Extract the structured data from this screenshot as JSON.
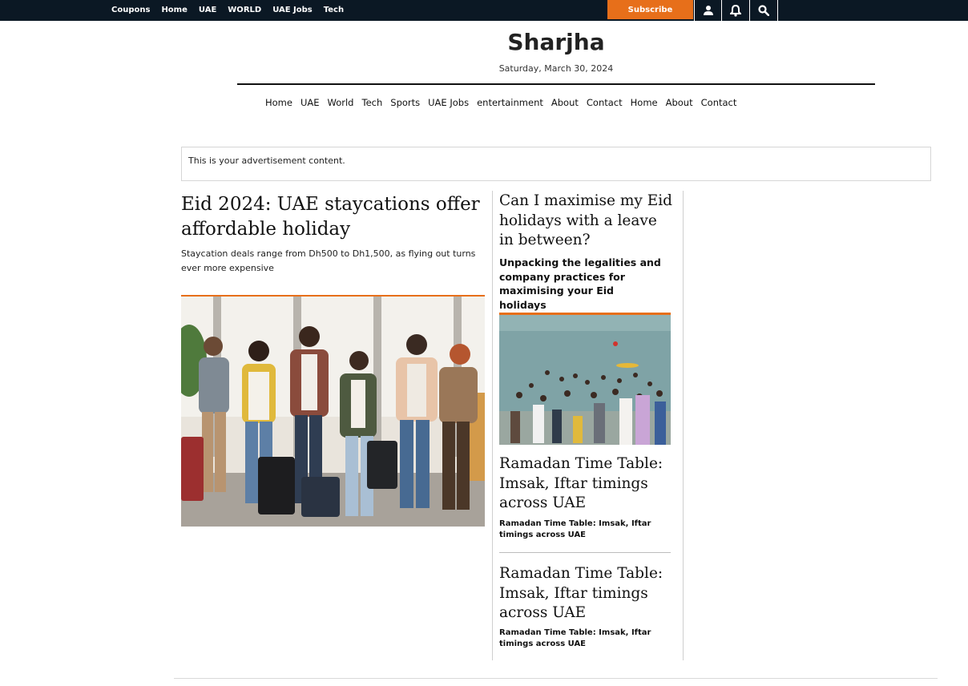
{
  "topbar": {
    "nav": [
      "Coupons",
      "Home",
      "UAE",
      "WORLD",
      "UAE Jobs",
      "Tech"
    ],
    "subscribe_label": "Subscribe",
    "icons": [
      "user-icon",
      "bell-icon",
      "search-icon"
    ]
  },
  "header": {
    "title": "Sharjha",
    "date": "Saturday, March 30, 2024"
  },
  "main_nav": [
    "Home",
    "UAE",
    "World",
    "Tech",
    "Sports",
    "UAE Jobs",
    "entertainment",
    "About",
    "Contact",
    "Home",
    "About",
    "Contact"
  ],
  "ad": {
    "text": "This is your advertisement content."
  },
  "lead": {
    "title": "Eid 2024: UAE staycations offer affordable holiday",
    "summary": "Staycation deals range from Dh500 to Dh1,500, as flying out turns ever more expensive"
  },
  "side": [
    {
      "title": "Can I maximise my Eid holidays with a leave in between?",
      "summary": "Unpacking the legalities and company practices for maximising your Eid holidays"
    },
    {
      "title": "Ramadan Time Table: Imsak, Iftar timings across UAE",
      "summary": "Ramadan Time Table: Imsak, Iftar timings across UAE"
    },
    {
      "title": "Ramadan Time Table: Imsak, Iftar timings across UAE",
      "summary": "Ramadan Time Table: Imsak, Iftar timings across UAE"
    }
  ],
  "colors": {
    "topbar": "#0b1824",
    "accent": "#e76f1a"
  }
}
